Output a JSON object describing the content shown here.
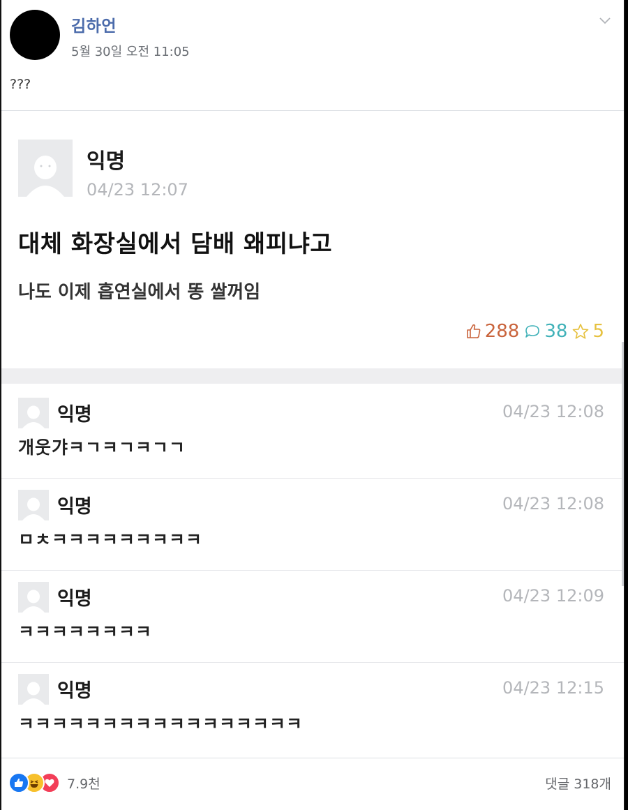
{
  "fb_post": {
    "author": "김하언",
    "timestamp": "5월 30일 오전 11:05",
    "caption": "???",
    "reaction_count": "7.9천",
    "comment_count": "댓글 318개",
    "reaction_icons": [
      "like-icon",
      "haha-icon",
      "love-icon"
    ]
  },
  "shared_post": {
    "author": "익명",
    "time": "04/23 12:07",
    "title": "대체 화장실에서 담배 왜피냐고",
    "body": "나도 이제 흡연실에서 똥 쌀꺼임",
    "stats": {
      "likes": "288",
      "comments": "38",
      "scraps": "5"
    },
    "comments": [
      {
        "author": "익명",
        "time": "04/23 12:08",
        "text": "개웃갸ㅋㄱㅋㄱㅋㄱㄱ"
      },
      {
        "author": "익명",
        "time": "04/23 12:08",
        "text": "ㅁㅊㅋㅋㅋㅋㅋㅋㅋㅋㅋ"
      },
      {
        "author": "익명",
        "time": "04/23 12:09",
        "text": "ㅋㅋㅋㅋㅋㅋㅋㅋ"
      },
      {
        "author": "익명",
        "time": "04/23 12:15",
        "text": "ㅋㅋㅋㅋㅋㅋㅋㅋㅋㅋㅋㅋㅋㅋㅋㅋㅋ"
      }
    ]
  },
  "colors": {
    "fb_author": "#4b6bab",
    "like_stat": "#c9633b",
    "comment_stat": "#3fb1b8",
    "scrap_stat": "#e6c13f"
  }
}
